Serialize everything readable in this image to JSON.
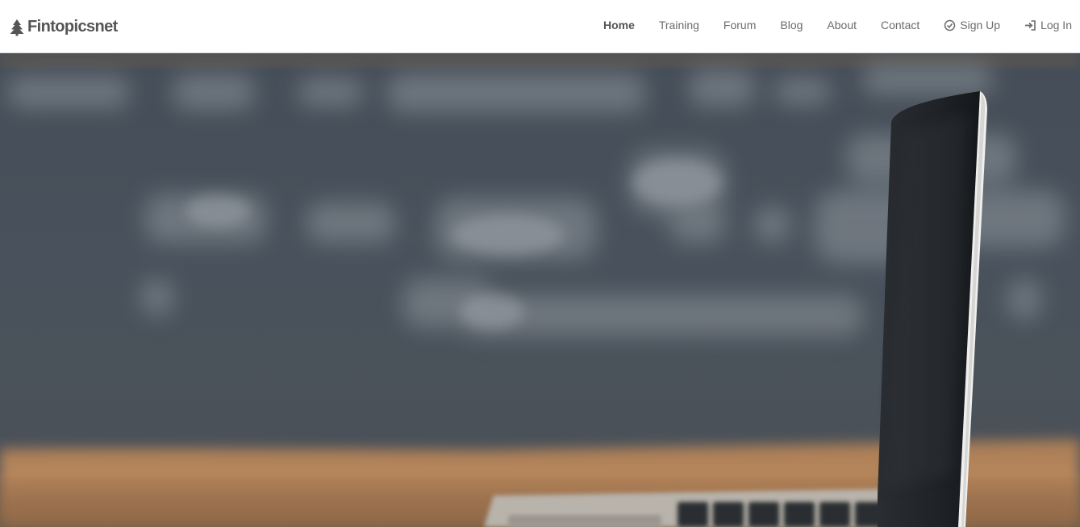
{
  "brand": {
    "name": "Fintopicsnet",
    "icon": "tree-icon"
  },
  "nav": {
    "items": [
      {
        "label": "Home",
        "active": true
      },
      {
        "label": "Training"
      },
      {
        "label": "Forum"
      },
      {
        "label": "Blog"
      },
      {
        "label": "About"
      },
      {
        "label": "Contact"
      },
      {
        "label": "Sign Up",
        "icon": "check-circle-icon"
      },
      {
        "label": "Log In",
        "icon": "sign-in-icon"
      }
    ]
  },
  "hero": {
    "image": "blurred-chalkboard-desk-laptop"
  },
  "colors": {
    "nav_text": "#6b6b6b",
    "brand_text": "#555555",
    "chalkboard": "#48515b",
    "desk": "#b7865b"
  }
}
